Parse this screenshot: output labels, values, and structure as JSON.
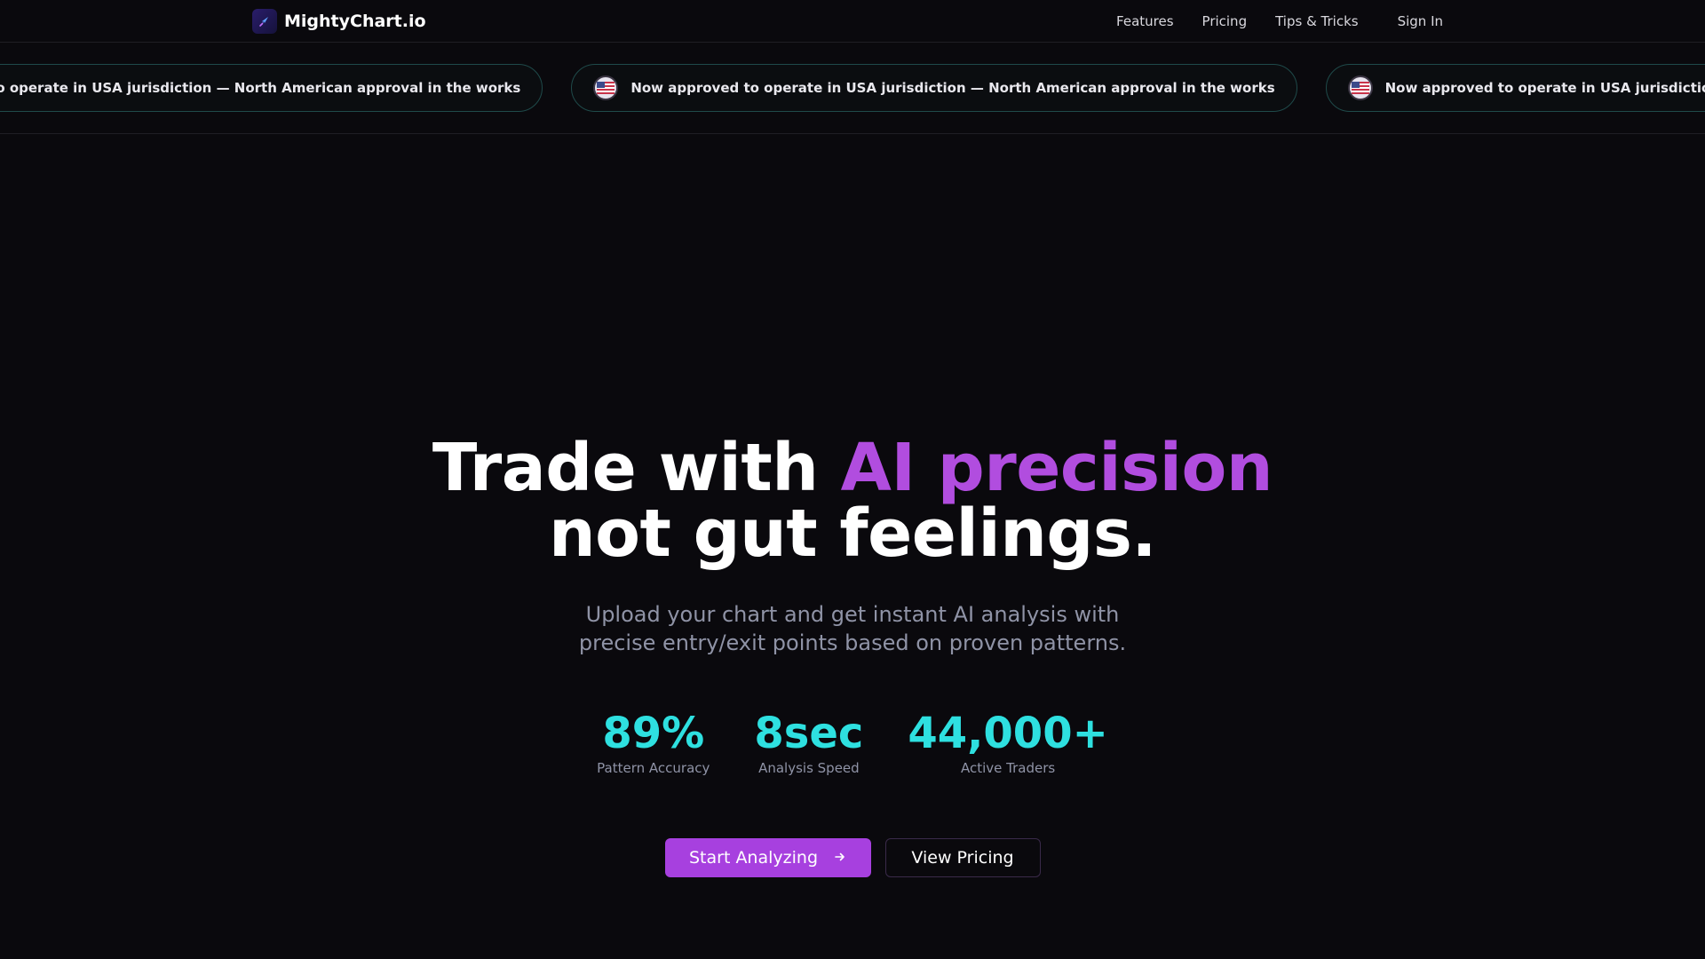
{
  "header": {
    "brand": "MightyChart.io",
    "nav": {
      "features": "Features",
      "pricing": "Pricing",
      "tips": "Tips & Tricks",
      "signin": "Sign In"
    }
  },
  "ticker": {
    "items": [
      "Now approved to operate in USA jurisdiction — North American approval in the works",
      "Now approved to operate in USA jurisdiction — North American approval in the works",
      "Now approved to operate in USA jurisdiction — North American approval in the works"
    ]
  },
  "hero": {
    "headline_part1": "Trade with ",
    "headline_accent": "AI precision",
    "headline_line2": "not gut feelings.",
    "subtitle_line1": "Upload your chart and get instant AI analysis with",
    "subtitle_line2": "precise entry/exit points based on proven patterns."
  },
  "stats": [
    {
      "value": "89%",
      "label": "Pattern Accuracy"
    },
    {
      "value": "8sec",
      "label": "Analysis Speed"
    },
    {
      "value": "44,000+",
      "label": "Active Traders"
    }
  ],
  "cta": {
    "primary": "Start Analyzing",
    "secondary": "View Pricing"
  },
  "colors": {
    "background": "#0a090d",
    "accent_purple": "#b14ddf",
    "button_purple": "#a740df",
    "stat_cyan": "#2ee0e0",
    "muted_text": "#8f93a6"
  },
  "icons": {
    "logo": "rocket-icon",
    "ticker": "us-flag-icon",
    "cta_primary": "arrow-right-icon"
  }
}
